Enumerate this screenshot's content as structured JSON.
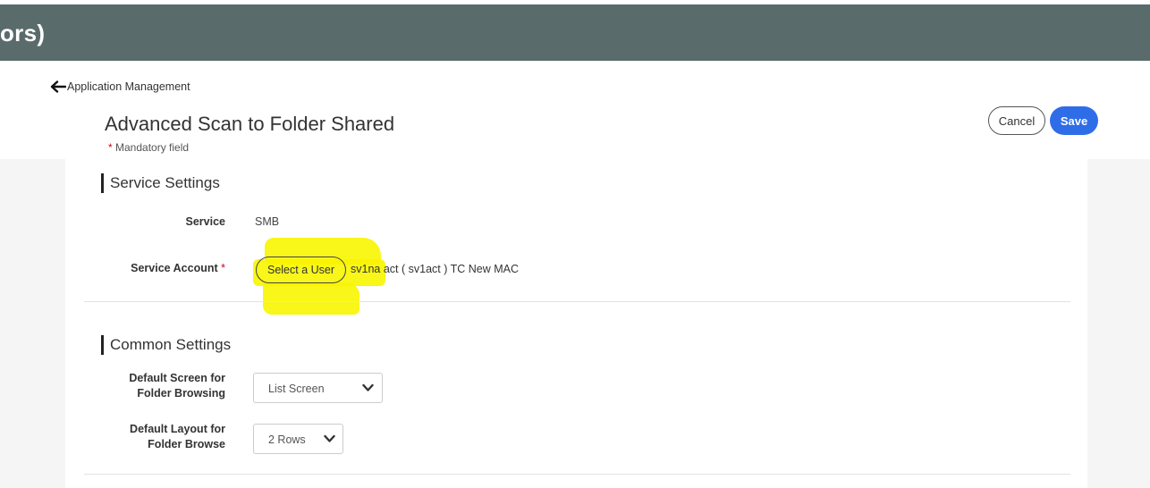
{
  "header": {
    "title": "ors)",
    "bar_color": "#5a6b6b"
  },
  "nav": {
    "back_label": "Application Management",
    "back_icon": "arrow-left-icon"
  },
  "page": {
    "title": "Advanced Scan to Folder Shared",
    "mandatory_star": "*",
    "mandatory_text": " Mandatory field"
  },
  "actions": {
    "cancel_label": "Cancel",
    "save_label": "Save",
    "save_color": "#2f6de8"
  },
  "service_settings": {
    "title": "Service Settings",
    "service_label": "Service",
    "service_value": "SMB",
    "account_label": "Service Account",
    "account_star": "*",
    "select_user_label": "Select a User",
    "account_value": "sv1na act ( sv1act ) TC New MAC",
    "highlight_color": "#f8f500"
  },
  "common_settings": {
    "title": "Common Settings",
    "screen_label_line1": "Default Screen for",
    "screen_label_line2": "Folder Browsing",
    "screen_value": "List Screen",
    "layout_label_line1": "Default Layout for",
    "layout_label_line2": "Folder Browse",
    "layout_value": "2 Rows"
  }
}
